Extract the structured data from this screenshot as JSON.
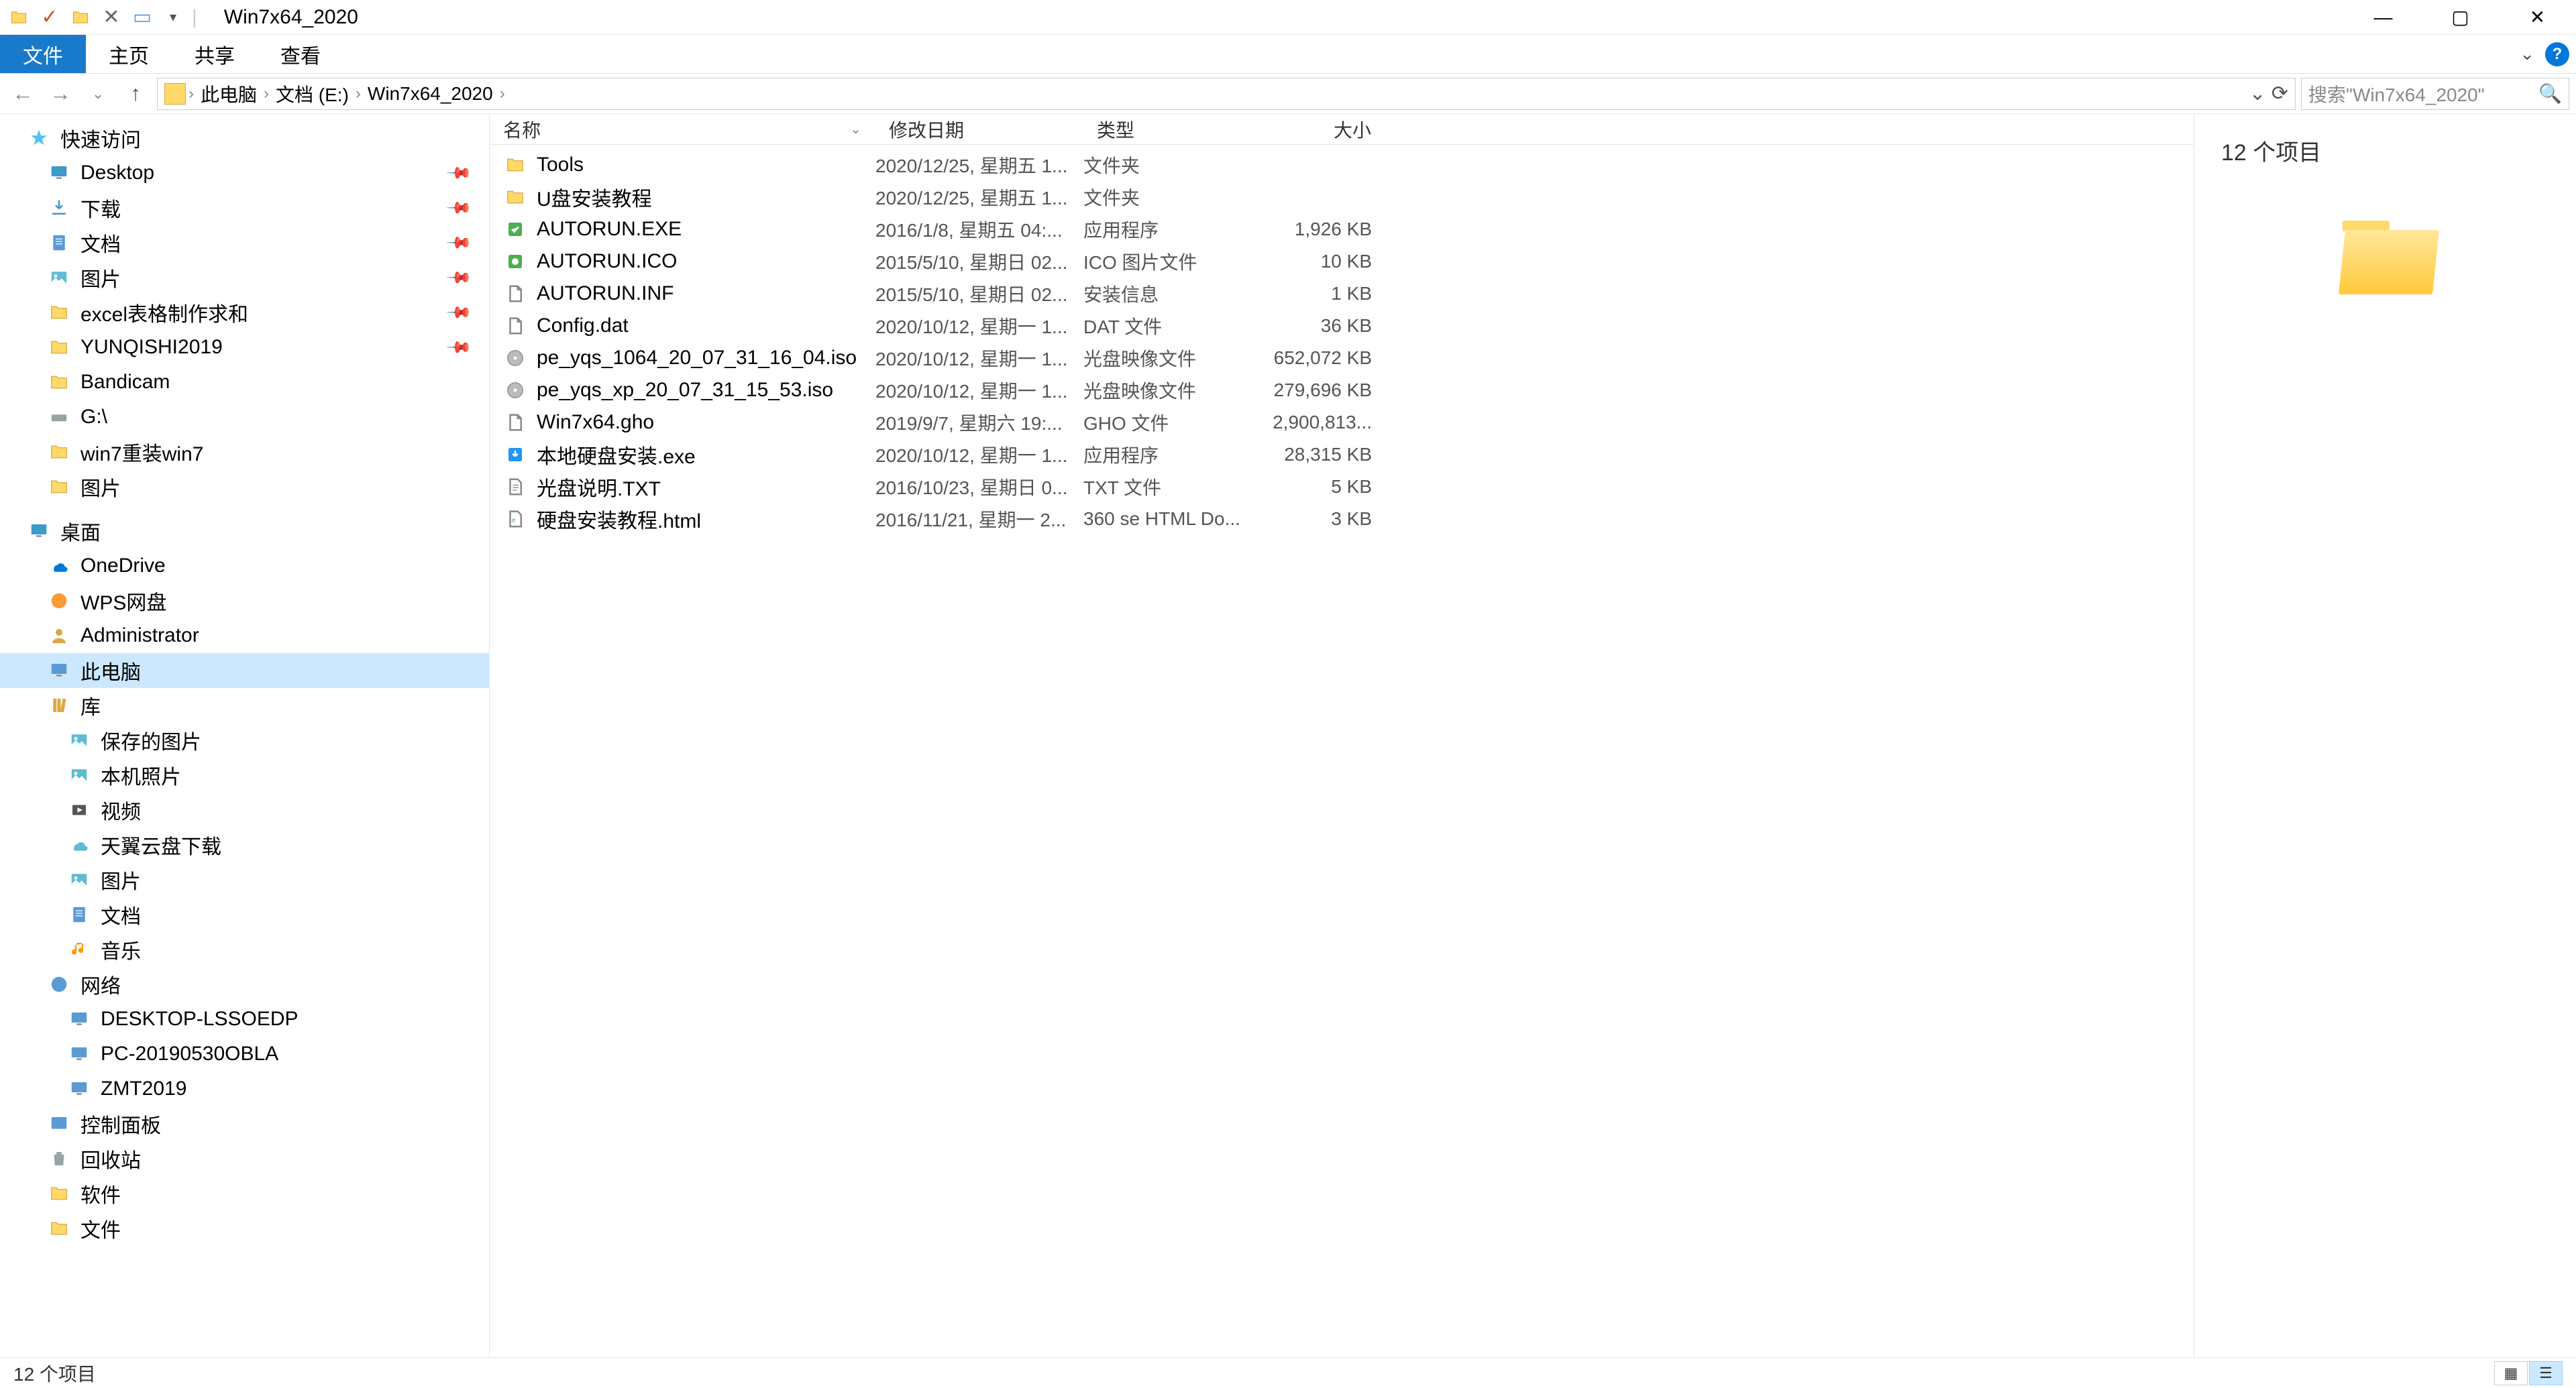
{
  "window": {
    "title": "Win7x64_2020"
  },
  "ribbon": {
    "file": "文件",
    "tabs": [
      "主页",
      "共享",
      "查看"
    ]
  },
  "breadcrumb": {
    "segments": [
      "此电脑",
      "文档 (E:)",
      "Win7x64_2020"
    ]
  },
  "search": {
    "placeholder": "搜索\"Win7x64_2020\""
  },
  "sidebar": {
    "quick_access": "快速访问",
    "quick_items": [
      {
        "label": "Desktop",
        "icon": "desktop",
        "pinned": true
      },
      {
        "label": "下载",
        "icon": "download",
        "pinned": true
      },
      {
        "label": "文档",
        "icon": "doc",
        "pinned": true
      },
      {
        "label": "图片",
        "icon": "pic",
        "pinned": true
      },
      {
        "label": "excel表格制作求和",
        "icon": "folder",
        "pinned": true
      },
      {
        "label": "YUNQISHI2019",
        "icon": "folder",
        "pinned": true
      },
      {
        "label": "Bandicam",
        "icon": "folder",
        "pinned": false
      },
      {
        "label": "G:\\",
        "icon": "drive",
        "pinned": false
      },
      {
        "label": "win7重装win7",
        "icon": "folder",
        "pinned": false
      },
      {
        "label": "图片",
        "icon": "folder",
        "pinned": false
      }
    ],
    "desktop": "桌面",
    "desktop_items": [
      {
        "label": "OneDrive",
        "icon": "onedrive"
      },
      {
        "label": "WPS网盘",
        "icon": "wps"
      },
      {
        "label": "Administrator",
        "icon": "user"
      },
      {
        "label": "此电脑",
        "icon": "pc",
        "selected": true
      },
      {
        "label": "库",
        "icon": "lib"
      }
    ],
    "lib_items": [
      {
        "label": "保存的图片",
        "icon": "pic"
      },
      {
        "label": "本机照片",
        "icon": "pic"
      },
      {
        "label": "视频",
        "icon": "video"
      },
      {
        "label": "天翼云盘下载",
        "icon": "cloud"
      },
      {
        "label": "图片",
        "icon": "pic"
      },
      {
        "label": "文档",
        "icon": "doc"
      },
      {
        "label": "音乐",
        "icon": "music"
      }
    ],
    "network": "网络",
    "net_items": [
      {
        "label": "DESKTOP-LSSOEDP",
        "icon": "pc"
      },
      {
        "label": "PC-20190530OBLA",
        "icon": "pc"
      },
      {
        "label": "ZMT2019",
        "icon": "pc"
      }
    ],
    "control_panel": "控制面板",
    "recycle": "回收站",
    "software": "软件",
    "files": "文件"
  },
  "columns": {
    "name": "名称",
    "date": "修改日期",
    "type": "类型",
    "size": "大小"
  },
  "files": [
    {
      "name": "Tools",
      "date": "2020/12/25, 星期五 1...",
      "type": "文件夹",
      "size": "",
      "icon": "folder"
    },
    {
      "name": "U盘安装教程",
      "date": "2020/12/25, 星期五 1...",
      "type": "文件夹",
      "size": "",
      "icon": "folder"
    },
    {
      "name": "AUTORUN.EXE",
      "date": "2016/1/8, 星期五 04:...",
      "type": "应用程序",
      "size": "1,926 KB",
      "icon": "exe"
    },
    {
      "name": "AUTORUN.ICO",
      "date": "2015/5/10, 星期日 02...",
      "type": "ICO 图片文件",
      "size": "10 KB",
      "icon": "ico"
    },
    {
      "name": "AUTORUN.INF",
      "date": "2015/5/10, 星期日 02...",
      "type": "安装信息",
      "size": "1 KB",
      "icon": "file"
    },
    {
      "name": "Config.dat",
      "date": "2020/10/12, 星期一 1...",
      "type": "DAT 文件",
      "size": "36 KB",
      "icon": "file"
    },
    {
      "name": "pe_yqs_1064_20_07_31_16_04.iso",
      "date": "2020/10/12, 星期一 1...",
      "type": "光盘映像文件",
      "size": "652,072 KB",
      "icon": "disc"
    },
    {
      "name": "pe_yqs_xp_20_07_31_15_53.iso",
      "date": "2020/10/12, 星期一 1...",
      "type": "光盘映像文件",
      "size": "279,696 KB",
      "icon": "disc"
    },
    {
      "name": "Win7x64.gho",
      "date": "2019/9/7, 星期六 19:...",
      "type": "GHO 文件",
      "size": "2,900,813...",
      "icon": "file"
    },
    {
      "name": "本地硬盘安装.exe",
      "date": "2020/10/12, 星期一 1...",
      "type": "应用程序",
      "size": "28,315 KB",
      "icon": "installer"
    },
    {
      "name": "光盘说明.TXT",
      "date": "2016/10/23, 星期日 0...",
      "type": "TXT 文件",
      "size": "5 KB",
      "icon": "txt"
    },
    {
      "name": "硬盘安装教程.html",
      "date": "2016/11/21, 星期一 2...",
      "type": "360 se HTML Do...",
      "size": "3 KB",
      "icon": "html"
    }
  ],
  "preview": {
    "count_text": "12 个项目"
  },
  "statusbar": {
    "text": "12 个项目"
  }
}
